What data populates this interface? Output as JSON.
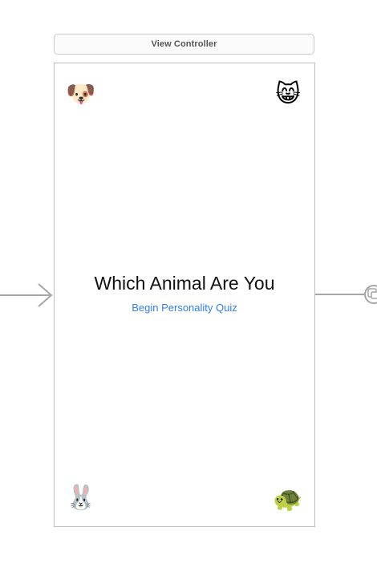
{
  "view_controller": {
    "title": "View Controller"
  },
  "scene": {
    "emojis": {
      "top_left": "🐶",
      "top_right": "😸",
      "bottom_left": "🐰",
      "bottom_right": "🐢"
    },
    "headline": "Which Animal Are You",
    "button_label": "Begin Personality Quiz"
  },
  "colors": {
    "button_text": "#2f7ef6",
    "headline_text": "#111111",
    "scene_border": "#bdbdbd"
  },
  "icons": {
    "entry_point": "initial-view-controller-arrow-icon",
    "segue": "segue-icon"
  }
}
